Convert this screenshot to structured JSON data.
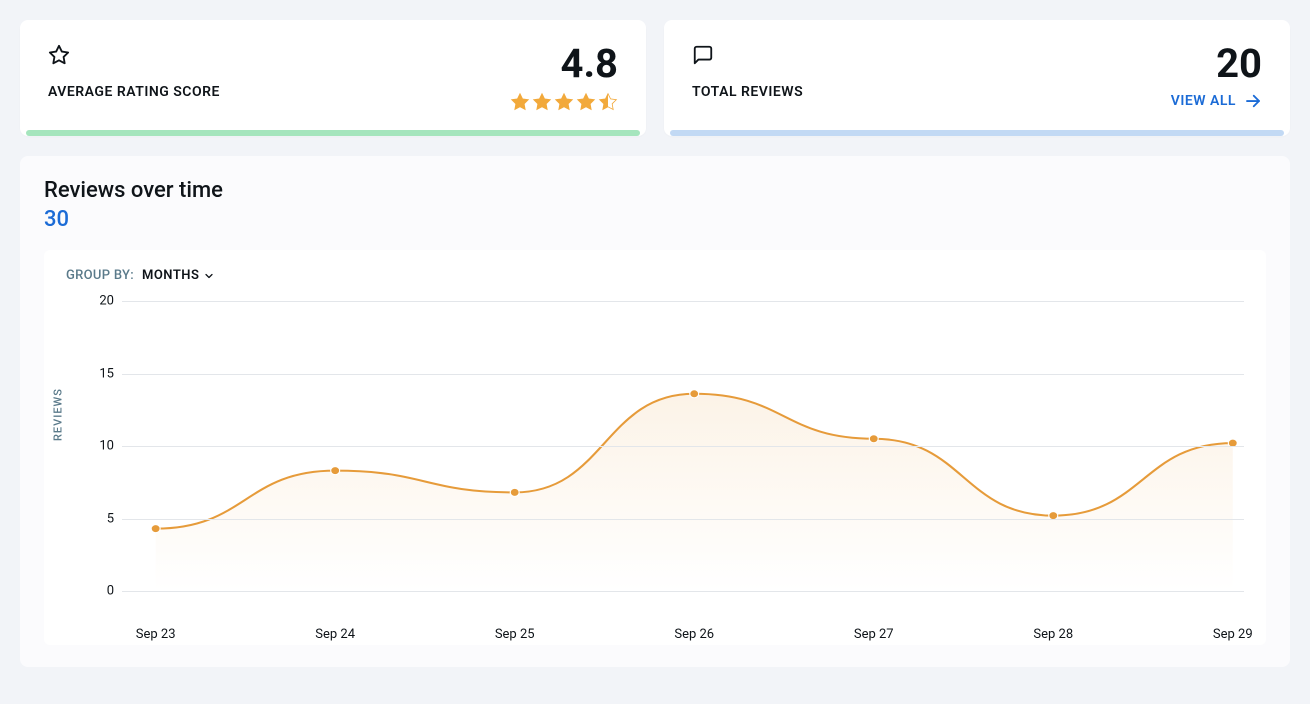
{
  "cards": {
    "rating": {
      "label": "AVERAGE RATING SCORE",
      "value": "4.8",
      "stars": 4.5,
      "underline_color": "#a5e5bd"
    },
    "total": {
      "label": "TOTAL REVIEWS",
      "value": "20",
      "view_all_label": "VIEW ALL",
      "underline_color": "#c2d9f4"
    }
  },
  "chart_section": {
    "title": "Reviews over time",
    "count": "30",
    "group_by_label": "GROUP BY:",
    "group_by_value": "MONTHS"
  },
  "chart_data": {
    "type": "line",
    "categories": [
      "Sep 23",
      "Sep 24",
      "Sep 25",
      "Sep 26",
      "Sep 27",
      "Sep 28",
      "Sep 29"
    ],
    "values": [
      4.3,
      8.3,
      6.8,
      13.6,
      10.5,
      5.2,
      10.2
    ],
    "title": "Reviews over time",
    "xlabel": "",
    "ylabel": "REVIEWS",
    "ylim": [
      0,
      20
    ],
    "yticks": [
      0,
      5,
      10,
      15,
      20
    ],
    "line_color": "#e69b3a",
    "fill_start": "rgba(230,155,58,0.12)",
    "fill_end": "rgba(230,155,58,0)"
  }
}
